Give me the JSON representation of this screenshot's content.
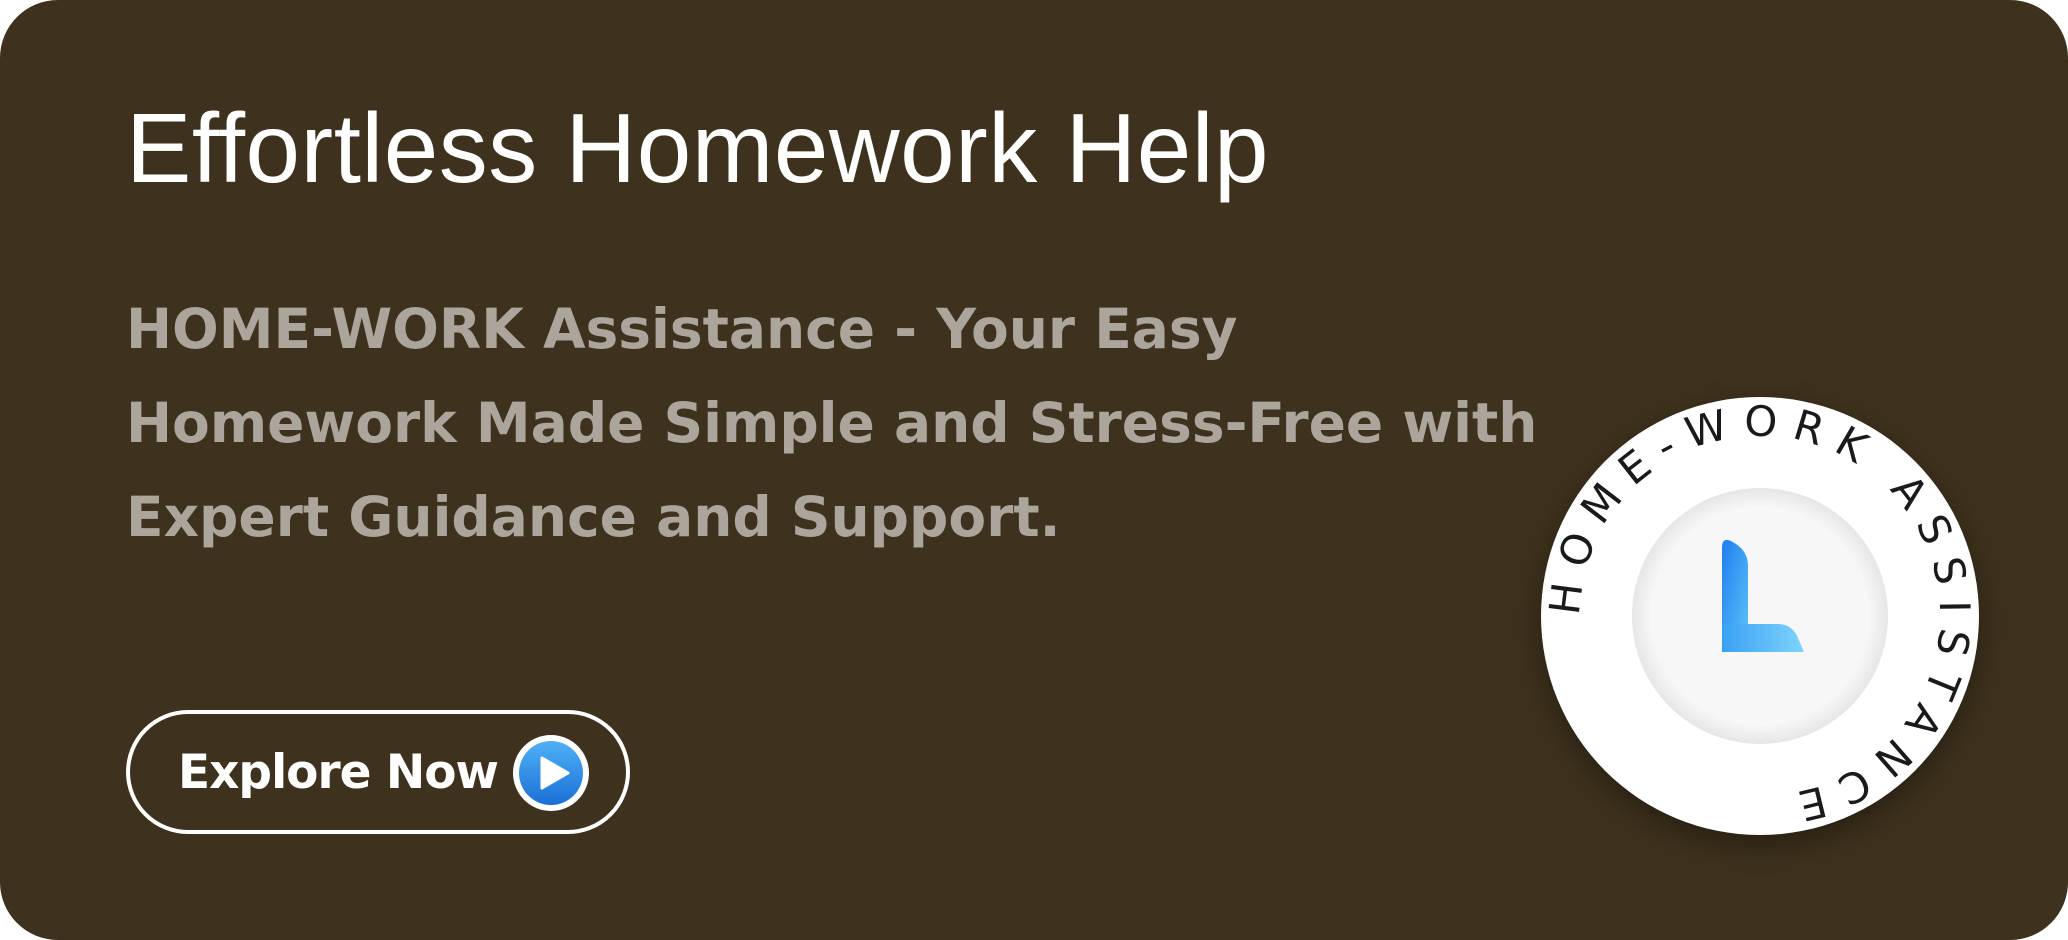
{
  "banner": {
    "title": "Effortless Homework Help",
    "subtitle_lines": [
      "HOME-WORK Assistance - Your Easy",
      "Homework Made Simple and Stress-Free with",
      "Expert Guidance and Support."
    ],
    "cta": {
      "label": "Explore Now",
      "icon": "play-icon"
    },
    "badge": {
      "ring_text": "HOME-WORK ASSISTANCE",
      "logo": "L-logo-icon"
    }
  },
  "colors": {
    "background": "#3e311d",
    "title": "#ffffff",
    "subtitle": "#aca59c",
    "accent_blue": "#2f8fe8",
    "badge_ring": "#ffffff"
  }
}
